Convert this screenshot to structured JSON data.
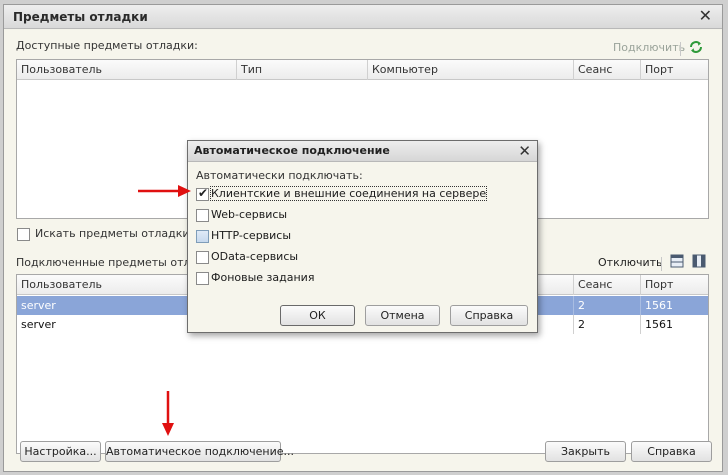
{
  "window": {
    "title": "Предметы отладки",
    "close_glyph": "✕"
  },
  "available": {
    "label": "Доступные предметы отладки:",
    "connect_label": "Подключить",
    "columns": [
      "Пользователь",
      "Тип",
      "Компьютер",
      "Сеанс",
      "Порт"
    ]
  },
  "search_checkbox": {
    "label": "Искать предметы отладки на у",
    "checked": false
  },
  "connected": {
    "label": "Подключенные предметы отладк",
    "disconnect_label": "Отключить",
    "columns": [
      "Пользователь",
      "Сеанс",
      "Порт"
    ],
    "rows": [
      {
        "user": "server",
        "session": "2",
        "port": "1561",
        "selected": true
      },
      {
        "user": "server",
        "session": "2",
        "port": "1561",
        "selected": false
      }
    ]
  },
  "footer": {
    "settings_label": "Настройка...",
    "auto_connect_label": "Автоматическое подключение...",
    "close_label": "Закрыть",
    "help_label": "Справка"
  },
  "modal": {
    "title": "Автоматическое подключение",
    "close_glyph": "✕",
    "heading": "Автоматически подключать:",
    "options": [
      {
        "label": "Клиентские и внешние соединения на сервере",
        "checked": true
      },
      {
        "label": "Web-сервисы",
        "checked": false
      },
      {
        "label": "HTTP-сервисы",
        "checked": false
      },
      {
        "label": "OData-сервисы",
        "checked": false
      },
      {
        "label": "Фоновые задания",
        "checked": false
      }
    ],
    "ok_label": "ОК",
    "cancel_label": "Отмена",
    "help_label": "Справка"
  },
  "icons": {
    "refresh": "refresh-icon",
    "grid_view": "table-icon",
    "columns_view": "columns-icon"
  },
  "colors": {
    "selection": "#8aa5d8",
    "arrow": "#e01010",
    "accent_green": "#2e9a3a"
  }
}
